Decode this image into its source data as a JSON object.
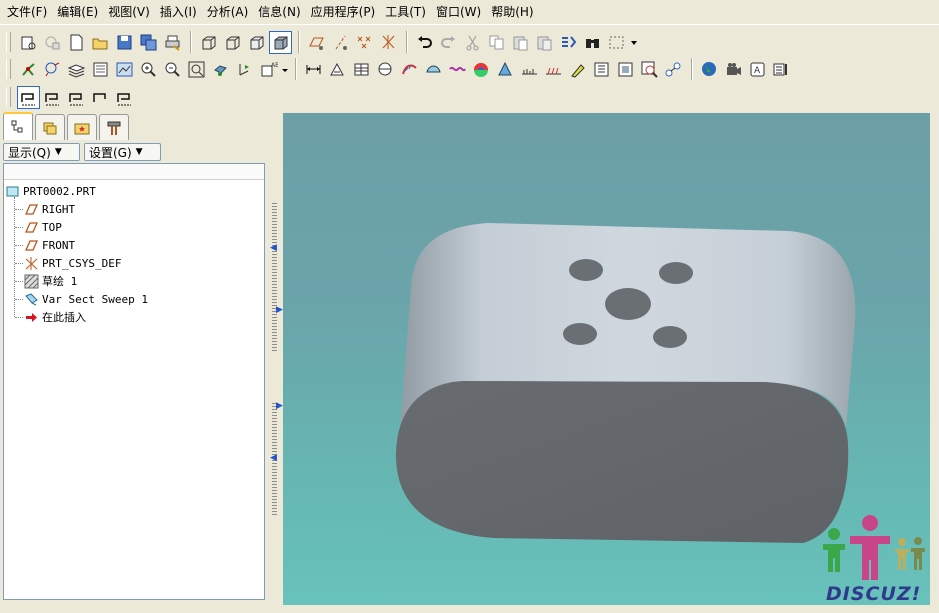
{
  "menu": [
    "文件(F)",
    "编辑(E)",
    "视图(V)",
    "插入(I)",
    "分析(A)",
    "信息(N)",
    "应用程序(P)",
    "工具(T)",
    "窗口(W)",
    "帮助(H)"
  ],
  "panel": {
    "show_button": "显示(Q)",
    "settings_button": "设置(G)"
  },
  "tree": {
    "root": "PRT0002.PRT",
    "items": [
      "RIGHT",
      "TOP",
      "FRONT",
      "PRT_CSYS_DEF",
      "草绘 1",
      "Var Sect Sweep 1",
      "在此插入"
    ]
  },
  "watermark": {
    "text": "DISCUZ!"
  },
  "colors": {
    "accent": "#316ac5",
    "viewport_top": "#6c9fa6",
    "viewport_bottom": "#68c2bc",
    "model_face": "#6a6e72",
    "model_side": "#c8d0d8"
  }
}
